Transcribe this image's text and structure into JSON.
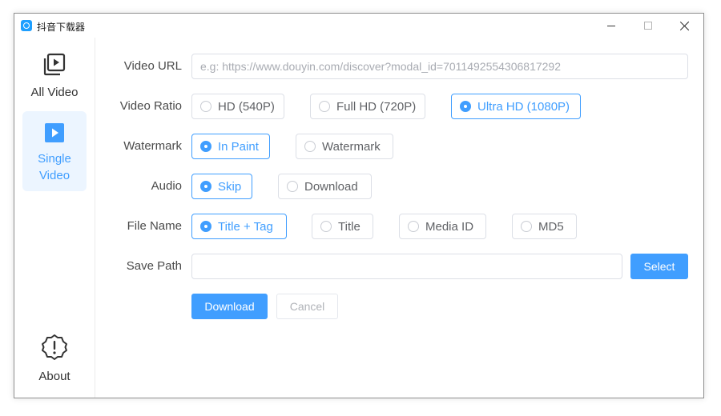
{
  "window": {
    "title": "抖音下载器"
  },
  "sidebar": {
    "items": [
      {
        "label": "All Video",
        "icon": "video-library-icon",
        "active": false
      },
      {
        "label": "Single Video",
        "icon": "play-square-icon",
        "active": true
      },
      {
        "label": "About",
        "icon": "warning-badge-icon",
        "active": false
      }
    ]
  },
  "form": {
    "video_url": {
      "label": "Video URL",
      "placeholder": "e.g: https://www.douyin.com/discover?modal_id=7011492554306817292",
      "value": ""
    },
    "video_ratio": {
      "label": "Video Ratio",
      "options": [
        "HD (540P)",
        "Full HD (720P)",
        "Ultra HD (1080P)"
      ],
      "selected": "Ultra HD (1080P)"
    },
    "watermark": {
      "label": "Watermark",
      "options": [
        "In Paint",
        "Watermark"
      ],
      "selected": "In Paint"
    },
    "audio": {
      "label": "Audio",
      "options": [
        "Skip",
        "Download"
      ],
      "selected": "Skip"
    },
    "file_name": {
      "label": "File Name",
      "options": [
        "Title + Tag",
        "Title",
        "Media ID",
        "MD5"
      ],
      "selected": "Title + Tag"
    },
    "save_path": {
      "label": "Save Path",
      "value": "",
      "select_label": "Select"
    }
  },
  "actions": {
    "download_label": "Download",
    "cancel_label": "Cancel"
  },
  "colors": {
    "accent": "#409eff",
    "active_bg": "#ecf5ff",
    "border": "#dcdfe6"
  }
}
